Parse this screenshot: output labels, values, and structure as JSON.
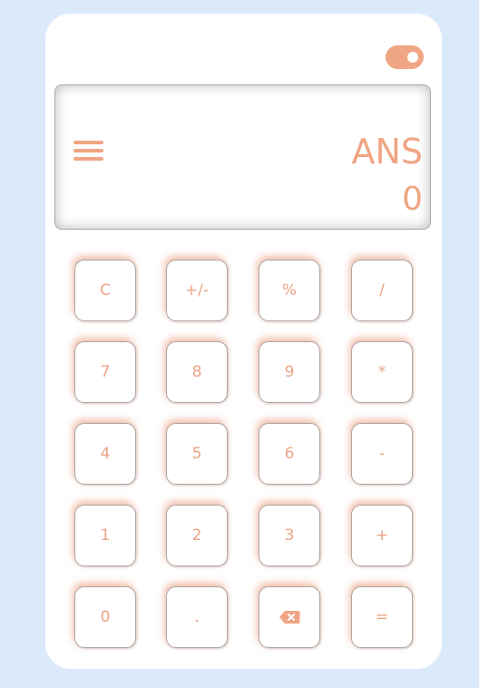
{
  "display": {
    "label": "ANS",
    "value": "0"
  },
  "keys": {
    "row1": [
      "C",
      "+/-",
      "%",
      "/"
    ],
    "row2": [
      "7",
      "8",
      "9",
      "*"
    ],
    "row3": [
      "4",
      "5",
      "6",
      "-"
    ],
    "row4": [
      "1",
      "2",
      "3",
      "+"
    ],
    "row5": [
      "0",
      ".",
      "",
      "="
    ]
  },
  "icons": {
    "toggle": "theme-toggle-switch",
    "menu": "hamburger-menu-icon",
    "backspace": "backspace-icon"
  },
  "colors": {
    "background": "#dbeafb",
    "accent": "#f0a583",
    "panel": "#ffffff",
    "key_border": "#b0a6a3"
  }
}
